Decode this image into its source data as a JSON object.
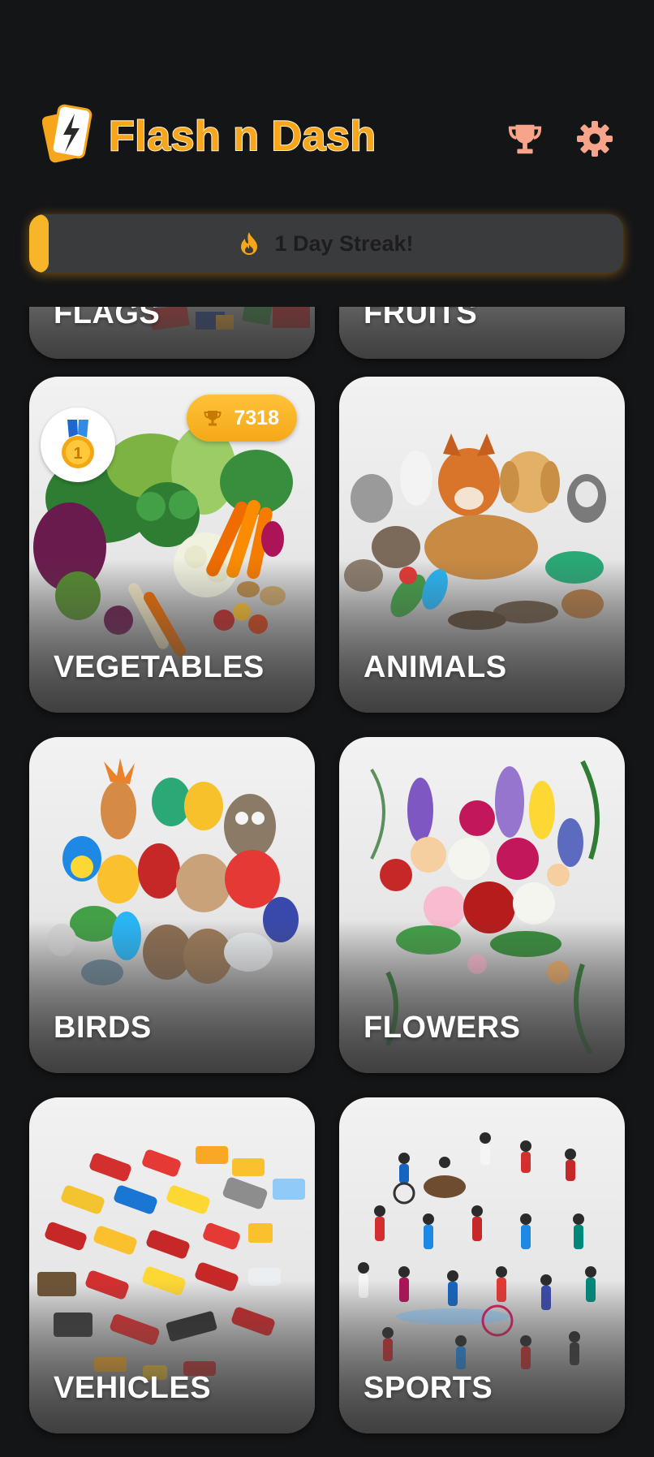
{
  "app": {
    "title": "Flash n Dash",
    "accent_color": "#f7a51a",
    "background_color": "#141517"
  },
  "header": {
    "logo_icon": "lightning-cards-icon",
    "actions": [
      {
        "name": "trophy",
        "icon": "trophy-icon",
        "color": "#f6a58a"
      },
      {
        "name": "settings",
        "icon": "gear-icon",
        "color": "#f6a58a"
      }
    ]
  },
  "streak": {
    "icon": "fire-icon",
    "text": "1 Day Streak!"
  },
  "categories": [
    {
      "label": "FLAGS"
    },
    {
      "label": "FRUITS"
    },
    {
      "label": "VEGETABLES",
      "medal_icon": "gold-medal-icon",
      "score": "7318",
      "score_icon": "trophy-icon"
    },
    {
      "label": "ANIMALS"
    },
    {
      "label": "BIRDS"
    },
    {
      "label": "FLOWERS"
    },
    {
      "label": "VEHICLES"
    },
    {
      "label": "SPORTS"
    }
  ]
}
